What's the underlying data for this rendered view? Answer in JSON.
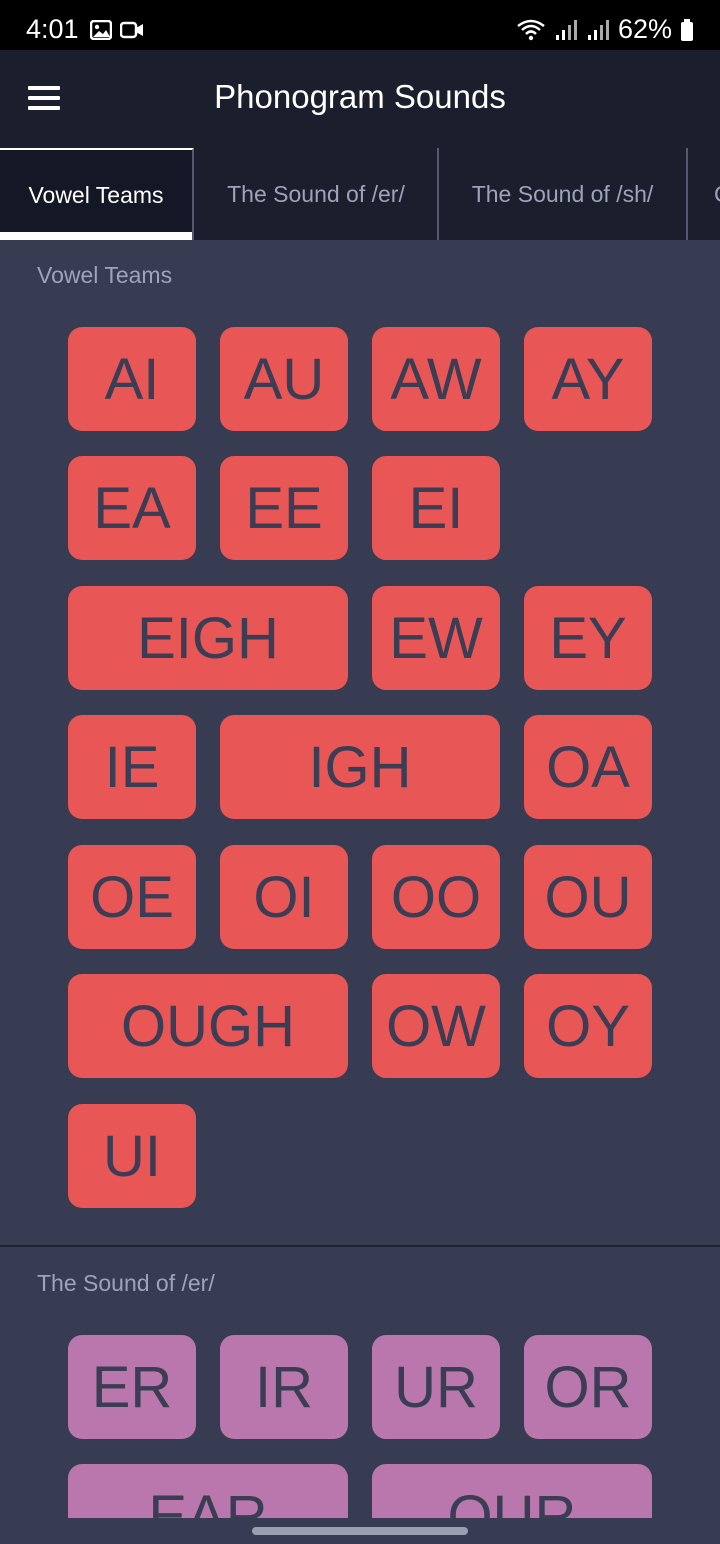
{
  "status": {
    "time": "4:01",
    "battery": "62%"
  },
  "appbar": {
    "title": "Phonogram Sounds",
    "menu_icon": "hamburger-menu-icon"
  },
  "tabs": [
    {
      "label": "Vowel Teams",
      "active": true
    },
    {
      "label": "The Sound of /er/",
      "active": false
    },
    {
      "label": "The Sound of /sh/",
      "active": false
    },
    {
      "label": "C",
      "active": false
    }
  ],
  "sections": [
    {
      "title": "Vowel Teams",
      "color": "#e95656",
      "tiles": [
        "AI",
        "AU",
        "AW",
        "AY",
        "EA",
        "EE",
        "EI",
        "EIGH",
        "EW",
        "EY",
        "IE",
        "IGH",
        "OA",
        "OE",
        "OI",
        "OO",
        "OU",
        "OUGH",
        "OW",
        "OY",
        "UI"
      ]
    },
    {
      "title": "The Sound of /er/",
      "color": "#b977ad",
      "tiles": [
        "ER",
        "IR",
        "UR",
        "OR",
        "EAR",
        "OUR"
      ]
    }
  ]
}
